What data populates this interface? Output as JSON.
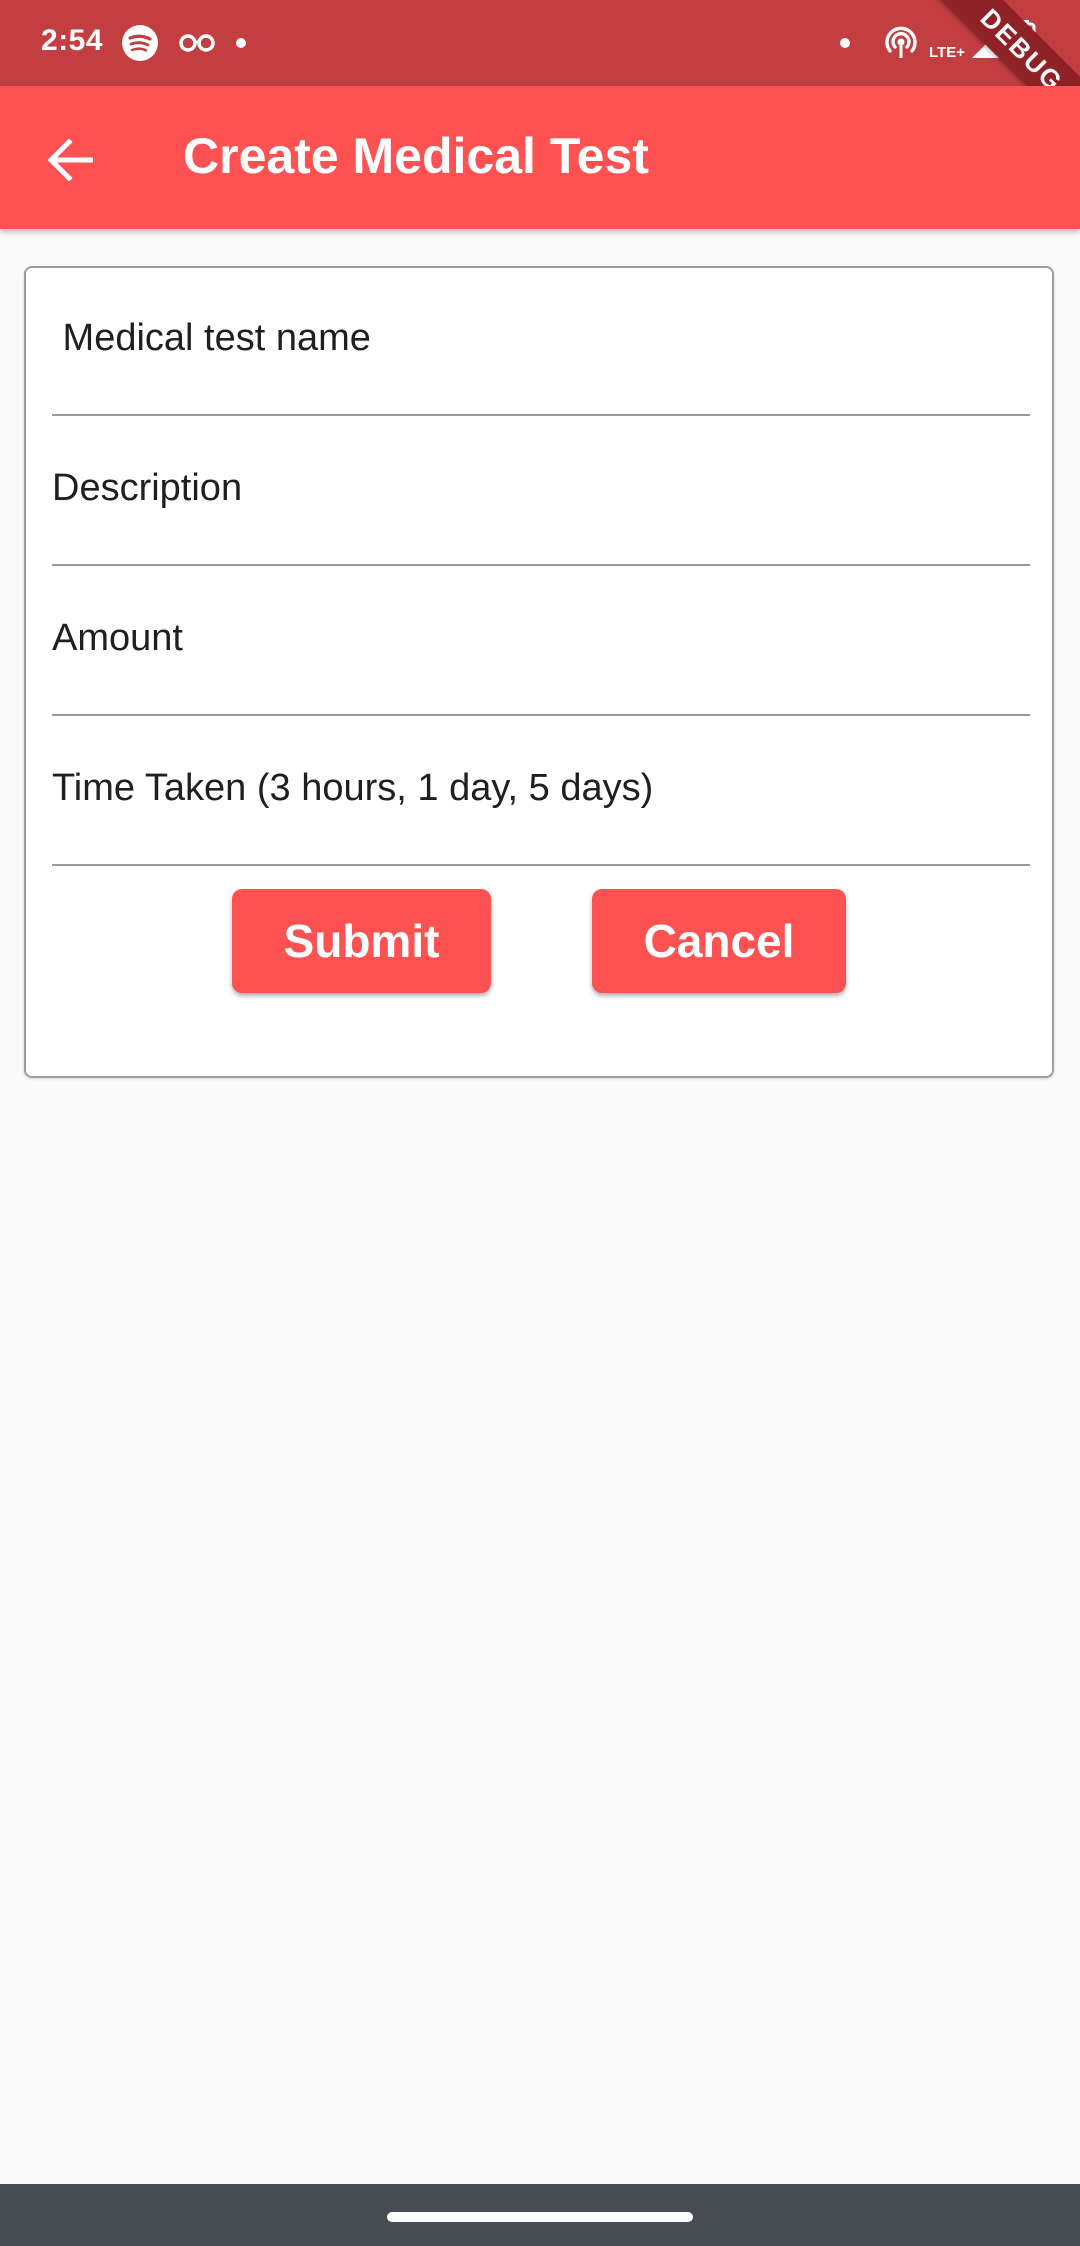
{
  "status_bar": {
    "time": "2:54",
    "network_label": "LTE+",
    "debug_label": "DEBUG",
    "icons": [
      "spotify-icon",
      "glasses-icon",
      "dot-icon",
      "hotspot-icon",
      "signal-icon",
      "battery-charging-icon"
    ]
  },
  "app_bar": {
    "title": "Create Medical Test",
    "back_icon": "arrow-left-icon",
    "background_color": "#fe5152"
  },
  "form": {
    "fields": [
      {
        "placeholder": " Medical test name",
        "value": ""
      },
      {
        "placeholder": "Description",
        "value": ""
      },
      {
        "placeholder": "Amount",
        "value": ""
      },
      {
        "placeholder": "Time Taken (3 hours, 1 day, 5 days)",
        "value": ""
      }
    ],
    "submit_label": "Submit",
    "cancel_label": "Cancel"
  },
  "colors": {
    "accent": "#fe5152",
    "status_bar": "#c23e40",
    "nav_bar": "#474c52",
    "background": "#fafafa"
  }
}
